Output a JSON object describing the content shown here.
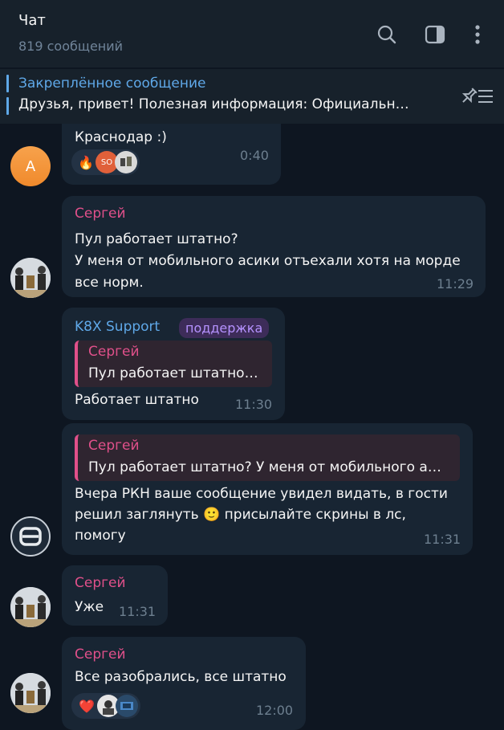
{
  "header": {
    "title": "Чат",
    "subtitle": "819 сообщений"
  },
  "pinned": {
    "title": "Закреплённое сообщение",
    "text": "Друзья, привет!  Полезная информация:  Официальн…"
  },
  "messages": [
    {
      "text": "Краснодар :)",
      "time": "0:40",
      "avatar_letter": "A",
      "reactions": [
        "🔥",
        "SO",
        "avatar"
      ]
    },
    {
      "sender": "Сергей",
      "text_lines": [
        "Пул работает штатно?",
        "У меня от мобильного асики отъехали хотя на морде",
        "все норм."
      ],
      "time": "11:29"
    },
    {
      "sender": "K8X Support",
      "badge": "поддержка",
      "reply_name": "Сергей",
      "reply_text": "Пул работает штатно…",
      "text": "Работает штатно",
      "time": "11:30"
    },
    {
      "reply_name": "Сергей",
      "reply_text": "Пул работает штатно? У меня от мобильного а…",
      "text_lines": [
        "Вчера РКН ваше сообщение увидел видать, в гости",
        "решил заглянуть 🙂 присылайте скрины в лс,",
        "помогу"
      ],
      "time": "11:31"
    },
    {
      "sender": "Сергей",
      "text": "Уже",
      "time": "11:31"
    },
    {
      "sender": "Сергей",
      "text": "Все разобрались, все штатно",
      "time": "12:00",
      "reactions": [
        "❤️",
        "avatar",
        "avatar"
      ]
    }
  ],
  "colors": {
    "background": "#0e1621",
    "header": "#17212b",
    "bubble": "#182533",
    "accent_blue": "#5fa8e8",
    "sender_pink": "#e0508a",
    "time": "#6d7f8f"
  }
}
